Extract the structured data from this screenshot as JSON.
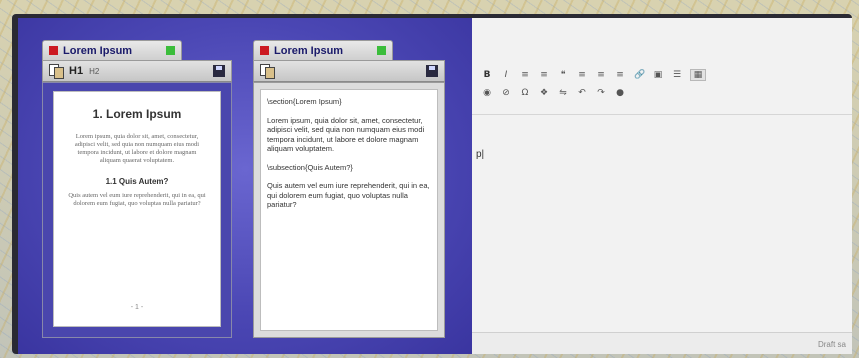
{
  "windows": [
    {
      "title": "Lorem Ipsum",
      "toolbar": {
        "h1": "H1",
        "h2": "H2"
      },
      "document": {
        "heading": "1. Lorem Ipsum",
        "para1": "Lorem ipsum, quia dolor sit, amet, consectetur, adipisci velit, sed quia non numquam eius modi tempora incidunt, ut labore et dolore magnam aliquam quaerat voluptatem.",
        "subheading": "1.1 Quis Autem?",
        "para2": "Quis autem vel eum iure reprehenderit, qui in ea, qui dolorem eum fugiat, quo voluptas nulla pariatur?",
        "page_number": "- 1 -"
      }
    },
    {
      "title": "Lorem Ipsum",
      "source": {
        "line1": "\\section{Lorem Ipsum}",
        "line2": "Lorem ipsum, quia dolor sit, amet, consectetur, adipisci velit, sed quia non numquam eius modi tempora incidunt, ut labore et dolore magnam aliquam voluptatem.",
        "line3": "\\subsection{Quis Autem?}",
        "line4": "Quis autem vel eum iure reprehenderit, qui in ea, qui dolorem eum fugiat, quo voluptas nulla pariatur?"
      }
    }
  ],
  "editor": {
    "toolbar_row1": [
      "B",
      "I",
      "≡",
      "≡",
      "❝",
      "≡",
      "≡",
      "≡",
      "🔗",
      "▣",
      "☰",
      "▦"
    ],
    "toolbar_row2": [
      "◉",
      "⊘",
      "Ω",
      "❖",
      "⇋",
      "↶",
      "↷",
      "●"
    ],
    "content": "p|",
    "status": "Draft sa"
  },
  "colors": {
    "panel_purple": "#4b47b4",
    "red_tab": "#cc1a22",
    "green_tab": "#3bbd3b"
  }
}
